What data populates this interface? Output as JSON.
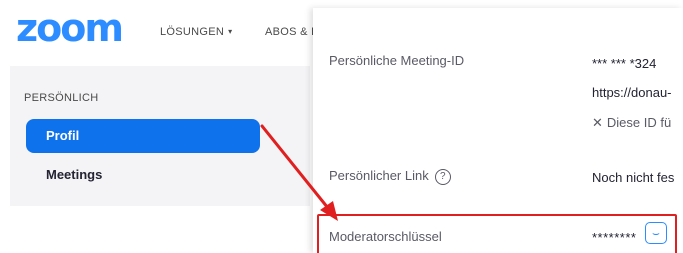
{
  "header": {
    "logo_text": "zoom",
    "nav": [
      {
        "label": "LÖSUNGEN",
        "has_dropdown": true
      },
      {
        "label": "ABOS & P"
      }
    ]
  },
  "sidebar": {
    "heading": "PERSÖNLICH",
    "items": [
      {
        "label": "Profil",
        "active": true
      },
      {
        "label": "Meetings"
      }
    ]
  },
  "panel": {
    "meeting_id_label": "Persönliche Meeting-ID",
    "meeting_id_value": "*** *** *324",
    "meeting_url": "https://donau-",
    "id_note": "Diese ID fü",
    "personal_link_label": "Persönlicher Link",
    "personal_link_value": "Noch nicht fes",
    "host_key_label": "Moderatorschlüssel",
    "host_key_value": "********"
  },
  "icons": {
    "caret": "▾",
    "x_icon": "✕",
    "help_icon": "?",
    "toggle_icon": "⌣"
  },
  "colors": {
    "brand": "#2d8cff",
    "active_item": "#0e72ed",
    "annotation": "#e02020"
  }
}
